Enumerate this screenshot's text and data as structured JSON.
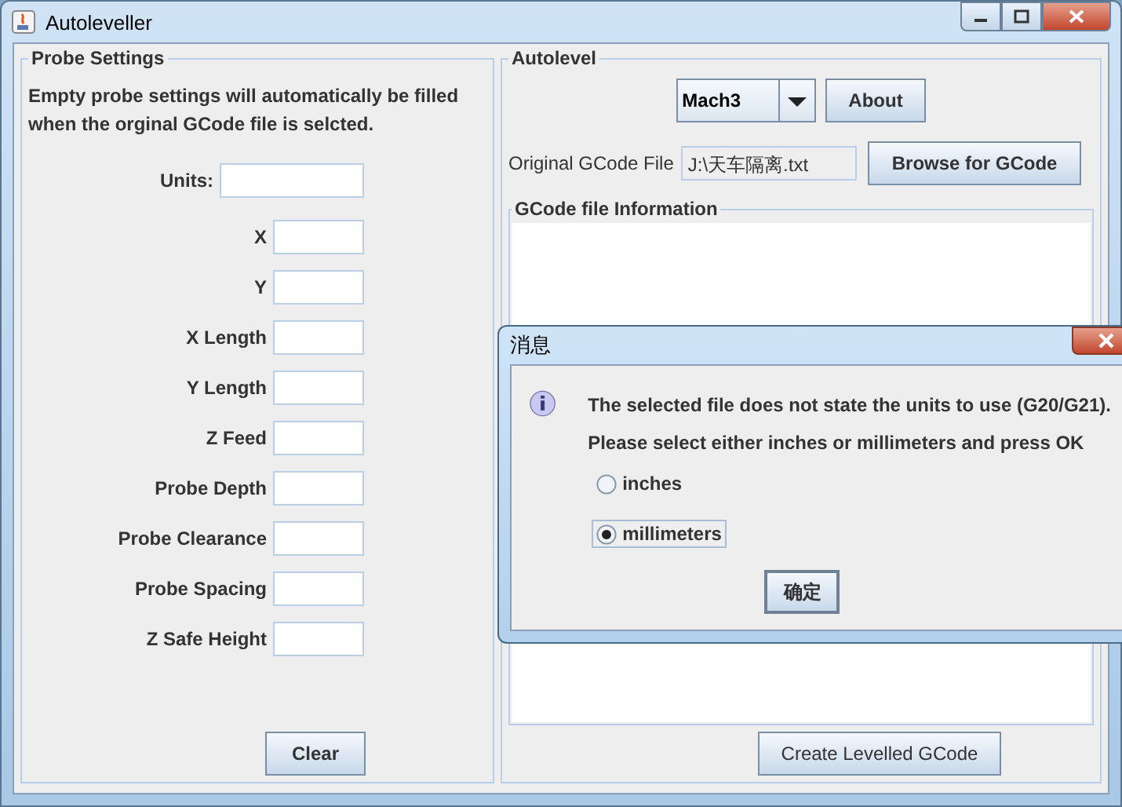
{
  "window": {
    "title": "Autoleveller"
  },
  "probe_settings": {
    "title": "Probe Settings",
    "description": "Empty probe settings will automatically be filled when the orginal GCode file is selcted.",
    "units": {
      "label": "Units:"
    },
    "fields": [
      {
        "label": "X"
      },
      {
        "label": "Y"
      },
      {
        "label": "X Length"
      },
      {
        "label": "Y Length"
      },
      {
        "label": "Z Feed"
      },
      {
        "label": "Probe Depth"
      },
      {
        "label": "Probe Clearance"
      },
      {
        "label": "Probe Spacing"
      },
      {
        "label": "Z Safe Height"
      }
    ],
    "clear_button": "Clear"
  },
  "autolevel": {
    "title": "Autolevel",
    "controller": "Mach3",
    "about_button": "About",
    "file_label": "Original GCode File",
    "file_value": "J:\\天车隔离.txt",
    "browse_button": "Browse for GCode",
    "info_title": "GCode file Information",
    "create_button": "Create Levelled GCode"
  },
  "dialog": {
    "title": "消息",
    "message": [
      "The selected file does not state the units to use (G20/G21).",
      "Please select either inches or millimeters and press OK"
    ],
    "options": [
      {
        "label": "inches",
        "selected": false,
        "focused": false
      },
      {
        "label": "millimeters",
        "selected": true,
        "focused": true
      }
    ],
    "ok_button": "确定"
  }
}
